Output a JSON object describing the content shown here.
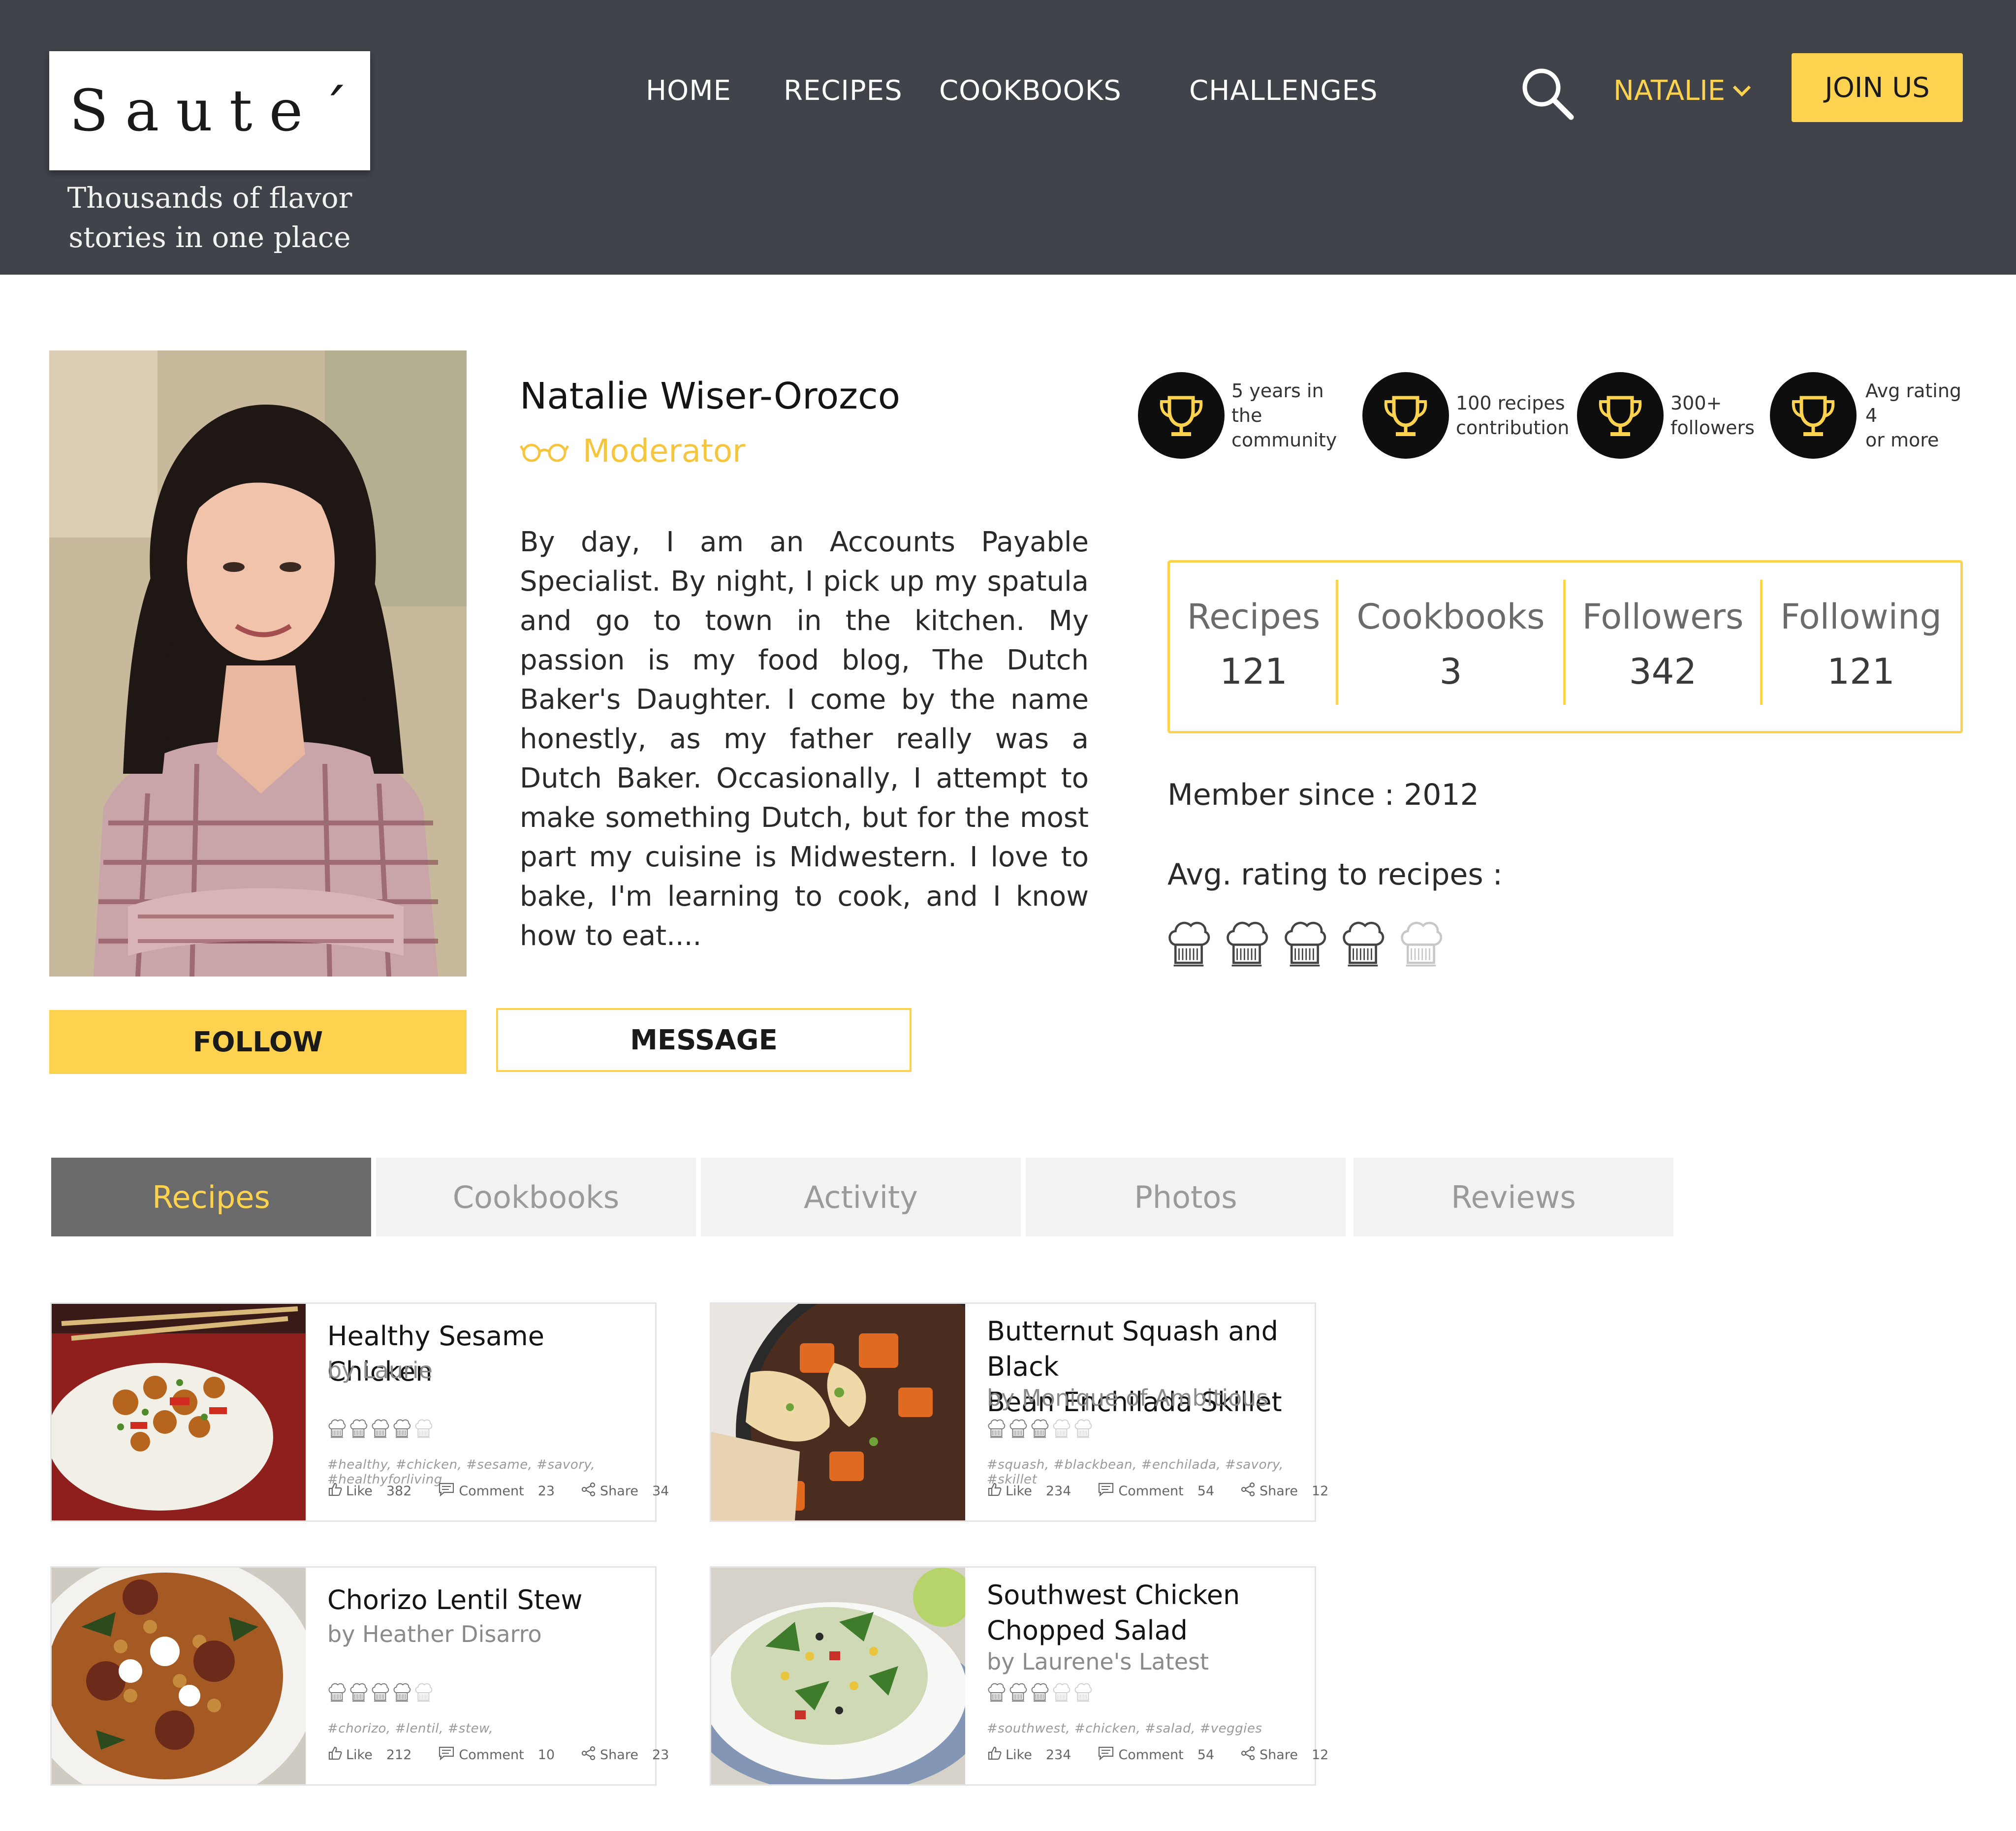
{
  "brand": {
    "logo": "Saute´",
    "tagline_line1": "Thousands of flavor",
    "tagline_line2": "stories in one place"
  },
  "nav": {
    "items": [
      "HOME",
      "RECIPES",
      "COOKBOOKS",
      "CHALLENGES"
    ],
    "user": "NATALIE",
    "join": "JOIN US"
  },
  "profile": {
    "name": "Natalie Wiser-Orozco",
    "role": "Moderator",
    "bio": "By day, I am an Accounts Payable Specialist. By night, I pick up my spatula and go to town in the kitchen. My passion is my food blog, The Dutch Baker's Daughter. I come by the name honestly, as my father really was a Dutch Baker. Occasionally, I attempt to make something Dutch, but for the most part my cuisine is Midwestern. I love to bake, I'm learning to cook, and I know how to eat....",
    "follow_label": "FOLLOW",
    "message_label": "MESSAGE"
  },
  "badges": [
    {
      "line1": "5 years in the",
      "line2": "community",
      "icon": "trophy-icon"
    },
    {
      "line1": "100 recipes",
      "line2": "contribution",
      "icon": "trophy-icon"
    },
    {
      "line1": "300+",
      "line2": "followers",
      "icon": "trophy-icon"
    },
    {
      "line1": "Avg rating 4",
      "line2": "or more",
      "icon": "trophy-icon"
    }
  ],
  "stats": [
    {
      "label": "Recipes",
      "value": "121"
    },
    {
      "label": "Cookbooks",
      "value": "3"
    },
    {
      "label": "Followers",
      "value": "342"
    },
    {
      "label": "Following",
      "value": "121"
    }
  ],
  "member_since": "Member since : 2012",
  "avg_rating": {
    "label": "Avg. rating to recipes :",
    "value": 4,
    "max": 5
  },
  "tabs": [
    "Recipes",
    "Cookbooks",
    "Activity",
    "Photos",
    "Reviews"
  ],
  "recipes": [
    {
      "title_line1": "Healthy Sesame Chicken",
      "title_line2": "",
      "author": "by Laurie",
      "rating": 4,
      "tags": "#healthy,   #chicken,   #sesame,   #savory,   #healthyforliving",
      "like_label": "Like",
      "likes": "382",
      "comment_label": "Comment",
      "comments": "23",
      "share_label": "Share",
      "shares": "34"
    },
    {
      "title_line1": "Butternut Squash and Black",
      "title_line2": "Bean Enchilada Skillet",
      "author": "by Monique of Ambitious",
      "rating": 3,
      "tags": "#squash,   #blackbean,   #enchilada,   #savory,   #skillet",
      "like_label": "Like",
      "likes": "234",
      "comment_label": "Comment",
      "comments": "54",
      "share_label": "Share",
      "shares": "12"
    },
    {
      "title_line1": "Chorizo Lentil Stew",
      "title_line2": "",
      "author": "by Heather Disarro",
      "rating": 4,
      "tags": "#chorizo,   #lentil,   #stew,",
      "like_label": "Like",
      "likes": "212",
      "comment_label": "Comment",
      "comments": "10",
      "share_label": "Share",
      "shares": "23"
    },
    {
      "title_line1": "Southwest Chicken",
      "title_line2": "Chopped Salad",
      "author": "by Laurene's Latest",
      "rating": 3,
      "tags": "#southwest,   #chicken,   #salad,   #veggies",
      "like_label": "Like",
      "likes": "234",
      "comment_label": "Comment",
      "comments": "54",
      "share_label": "Share",
      "shares": "12"
    }
  ],
  "colors": {
    "header_bg": "#40434a",
    "accent": "#fcd24f",
    "tab_active_bg": "#6a6a6b",
    "tab_bg": "#f2f2f2"
  }
}
